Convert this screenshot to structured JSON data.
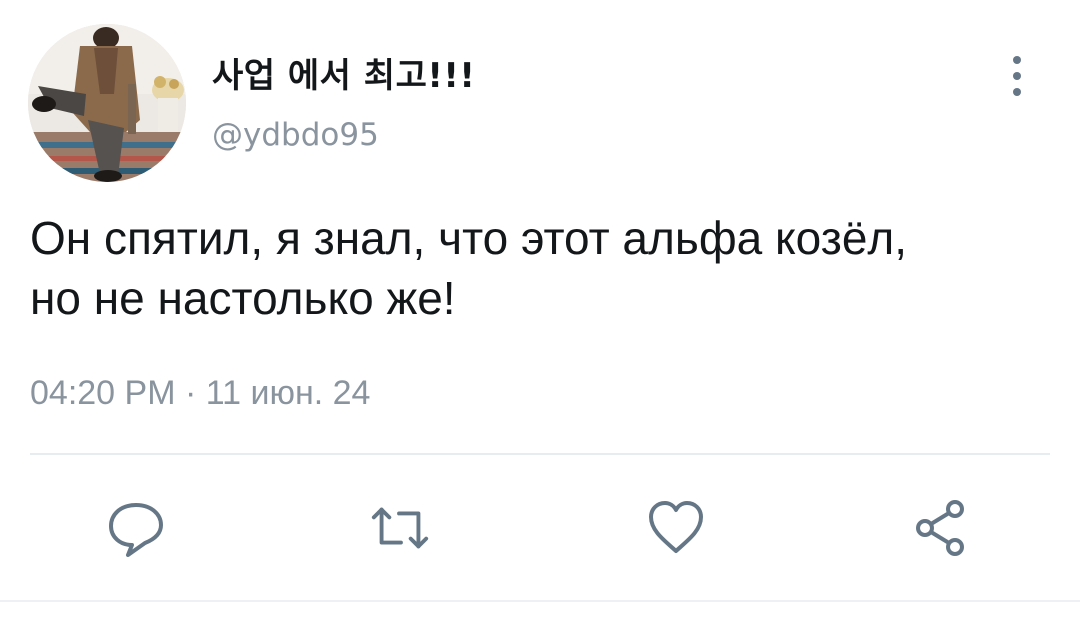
{
  "user": {
    "display_name": "사업 에서 최고!!!",
    "handle": "@ydbdo95",
    "avatar_icon": "profile-photo"
  },
  "tweet": {
    "text_line1": "Он спятил, я знал, что этот альфа козёл,",
    "text_line2": "но не настолько же!",
    "timestamp": "04:20 PM · 11 июн. 24"
  },
  "actions": {
    "reply_icon": "speech-bubble-icon",
    "retweet_icon": "retweet-icon",
    "like_icon": "heart-icon",
    "share_icon": "share-icon"
  },
  "colors": {
    "text": "#14171a",
    "secondary": "#8a949e",
    "icon": "#657786",
    "divider": "#e6ecf0"
  }
}
